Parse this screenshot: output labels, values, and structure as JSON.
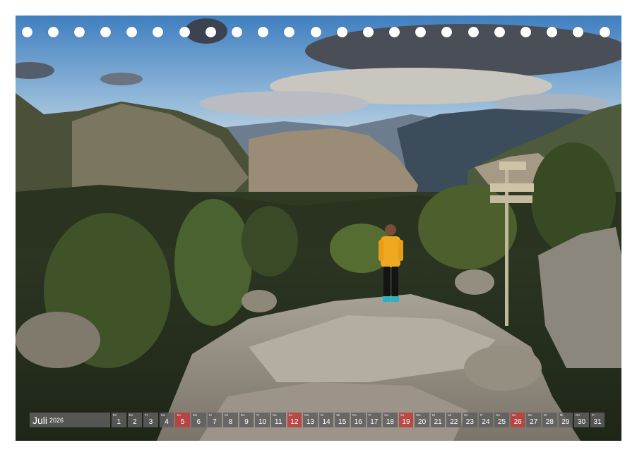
{
  "calendar": {
    "month": "Juli",
    "year": "2026",
    "days": [
      {
        "num": "1",
        "wd": "Mi",
        "sun": false
      },
      {
        "num": "2",
        "wd": "Do",
        "sun": false
      },
      {
        "num": "3",
        "wd": "Fr",
        "sun": false
      },
      {
        "num": "4",
        "wd": "Sa",
        "sun": false
      },
      {
        "num": "5",
        "wd": "So",
        "sun": true
      },
      {
        "num": "6",
        "wd": "Mo",
        "sun": false
      },
      {
        "num": "7",
        "wd": "Di",
        "sun": false
      },
      {
        "num": "8",
        "wd": "Mi",
        "sun": false
      },
      {
        "num": "9",
        "wd": "Do",
        "sun": false
      },
      {
        "num": "10",
        "wd": "Fr",
        "sun": false
      },
      {
        "num": "11",
        "wd": "Sa",
        "sun": false
      },
      {
        "num": "12",
        "wd": "So",
        "sun": true
      },
      {
        "num": "13",
        "wd": "Mo",
        "sun": false
      },
      {
        "num": "14",
        "wd": "Di",
        "sun": false
      },
      {
        "num": "15",
        "wd": "Mi",
        "sun": false
      },
      {
        "num": "16",
        "wd": "Do",
        "sun": false
      },
      {
        "num": "17",
        "wd": "Fr",
        "sun": false
      },
      {
        "num": "18",
        "wd": "Sa",
        "sun": false
      },
      {
        "num": "19",
        "wd": "So",
        "sun": true
      },
      {
        "num": "20",
        "wd": "Mo",
        "sun": false
      },
      {
        "num": "21",
        "wd": "Di",
        "sun": false
      },
      {
        "num": "22",
        "wd": "Mi",
        "sun": false
      },
      {
        "num": "23",
        "wd": "Do",
        "sun": false
      },
      {
        "num": "24",
        "wd": "Fr",
        "sun": false
      },
      {
        "num": "25",
        "wd": "Sa",
        "sun": false
      },
      {
        "num": "26",
        "wd": "So",
        "sun": true
      },
      {
        "num": "27",
        "wd": "Mo",
        "sun": false
      },
      {
        "num": "28",
        "wd": "Di",
        "sun": false
      },
      {
        "num": "29",
        "wd": "Mi",
        "sun": false
      },
      {
        "num": "30",
        "wd": "Do",
        "sun": false
      },
      {
        "num": "31",
        "wd": "Fr",
        "sun": false
      }
    ]
  },
  "binding": {
    "ring_count": 23
  },
  "colors": {
    "day_cell": "#5f5f5f",
    "sunday_cell": "#be3c3c",
    "page": "#ffffff"
  }
}
